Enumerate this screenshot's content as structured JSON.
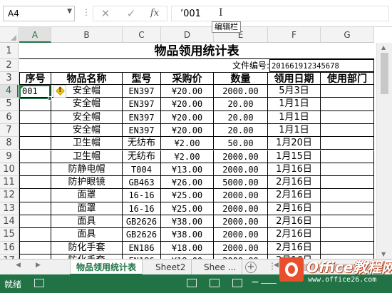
{
  "formula_bar": {
    "name_box": "A4",
    "cancel_icon": "✕",
    "enter_icon": "✓",
    "fx_label": "fx",
    "content": "’001",
    "tooltip": "编辑栏"
  },
  "columns": [
    "A",
    "B",
    "C",
    "D",
    "E",
    "F",
    "G"
  ],
  "rows": [
    "1",
    "2",
    "3",
    "4",
    "5",
    "6",
    "7",
    "8",
    "9",
    "10",
    "11",
    "12",
    "13",
    "14",
    "15",
    "16",
    "17"
  ],
  "sheet": {
    "title": "物品领用统计表",
    "doc_label": "文件编号:",
    "doc_number": "201661912345678",
    "headers": [
      "序号",
      "物品名称",
      "型号",
      "采购价",
      "数量",
      "领用日期",
      "使用部门"
    ],
    "data": [
      [
        "001",
        "安全帽",
        "EN397",
        "¥20.00",
        "2000.00",
        "5月3日",
        ""
      ],
      [
        "",
        "安全帽",
        "EN397",
        "¥20.00",
        "20.00",
        "1月1日",
        ""
      ],
      [
        "",
        "安全帽",
        "EN397",
        "¥20.00",
        "20.00",
        "1月1日",
        ""
      ],
      [
        "",
        "安全帽",
        "EN397",
        "¥20.00",
        "20.00",
        "1月1日",
        ""
      ],
      [
        "",
        "卫生帽",
        "无纺布",
        "¥2.00",
        "50.00",
        "1月20日",
        ""
      ],
      [
        "",
        "卫生帽",
        "无纺布",
        "¥2.00",
        "2000.00",
        "1月15日",
        ""
      ],
      [
        "",
        "防静电帽",
        "T004",
        "¥13.00",
        "2000.00",
        "1月16日",
        ""
      ],
      [
        "",
        "防护眼镜",
        "GB463",
        "¥26.00",
        "5000.00",
        "2月16日",
        ""
      ],
      [
        "",
        "面罩",
        "16-16",
        "¥25.00",
        "2000.00",
        "2月16日",
        ""
      ],
      [
        "",
        "面罩",
        "16-16",
        "¥25.00",
        "2000.00",
        "2月16日",
        ""
      ],
      [
        "",
        "面具",
        "GB2626",
        "¥38.00",
        "2000.00",
        "2月16日",
        ""
      ],
      [
        "",
        "面具",
        "GB2626",
        "¥38.00",
        "2000.00",
        "2月16日",
        ""
      ],
      [
        "",
        "防化手套",
        "EN186",
        "¥18.00",
        "2000.00",
        "2月16日",
        ""
      ],
      [
        "",
        "防化手套",
        "EN186",
        "¥18.00",
        "2000.00",
        "2月16日",
        ""
      ]
    ]
  },
  "tabs": {
    "sheet1": "物品领用统计表",
    "sheet2": "Sheet2",
    "sheet3": "Shee ...",
    "add": "+"
  },
  "status": {
    "text": "就绪"
  },
  "watermark": {
    "name": "Office教程网",
    "url": "www.office26.com"
  }
}
